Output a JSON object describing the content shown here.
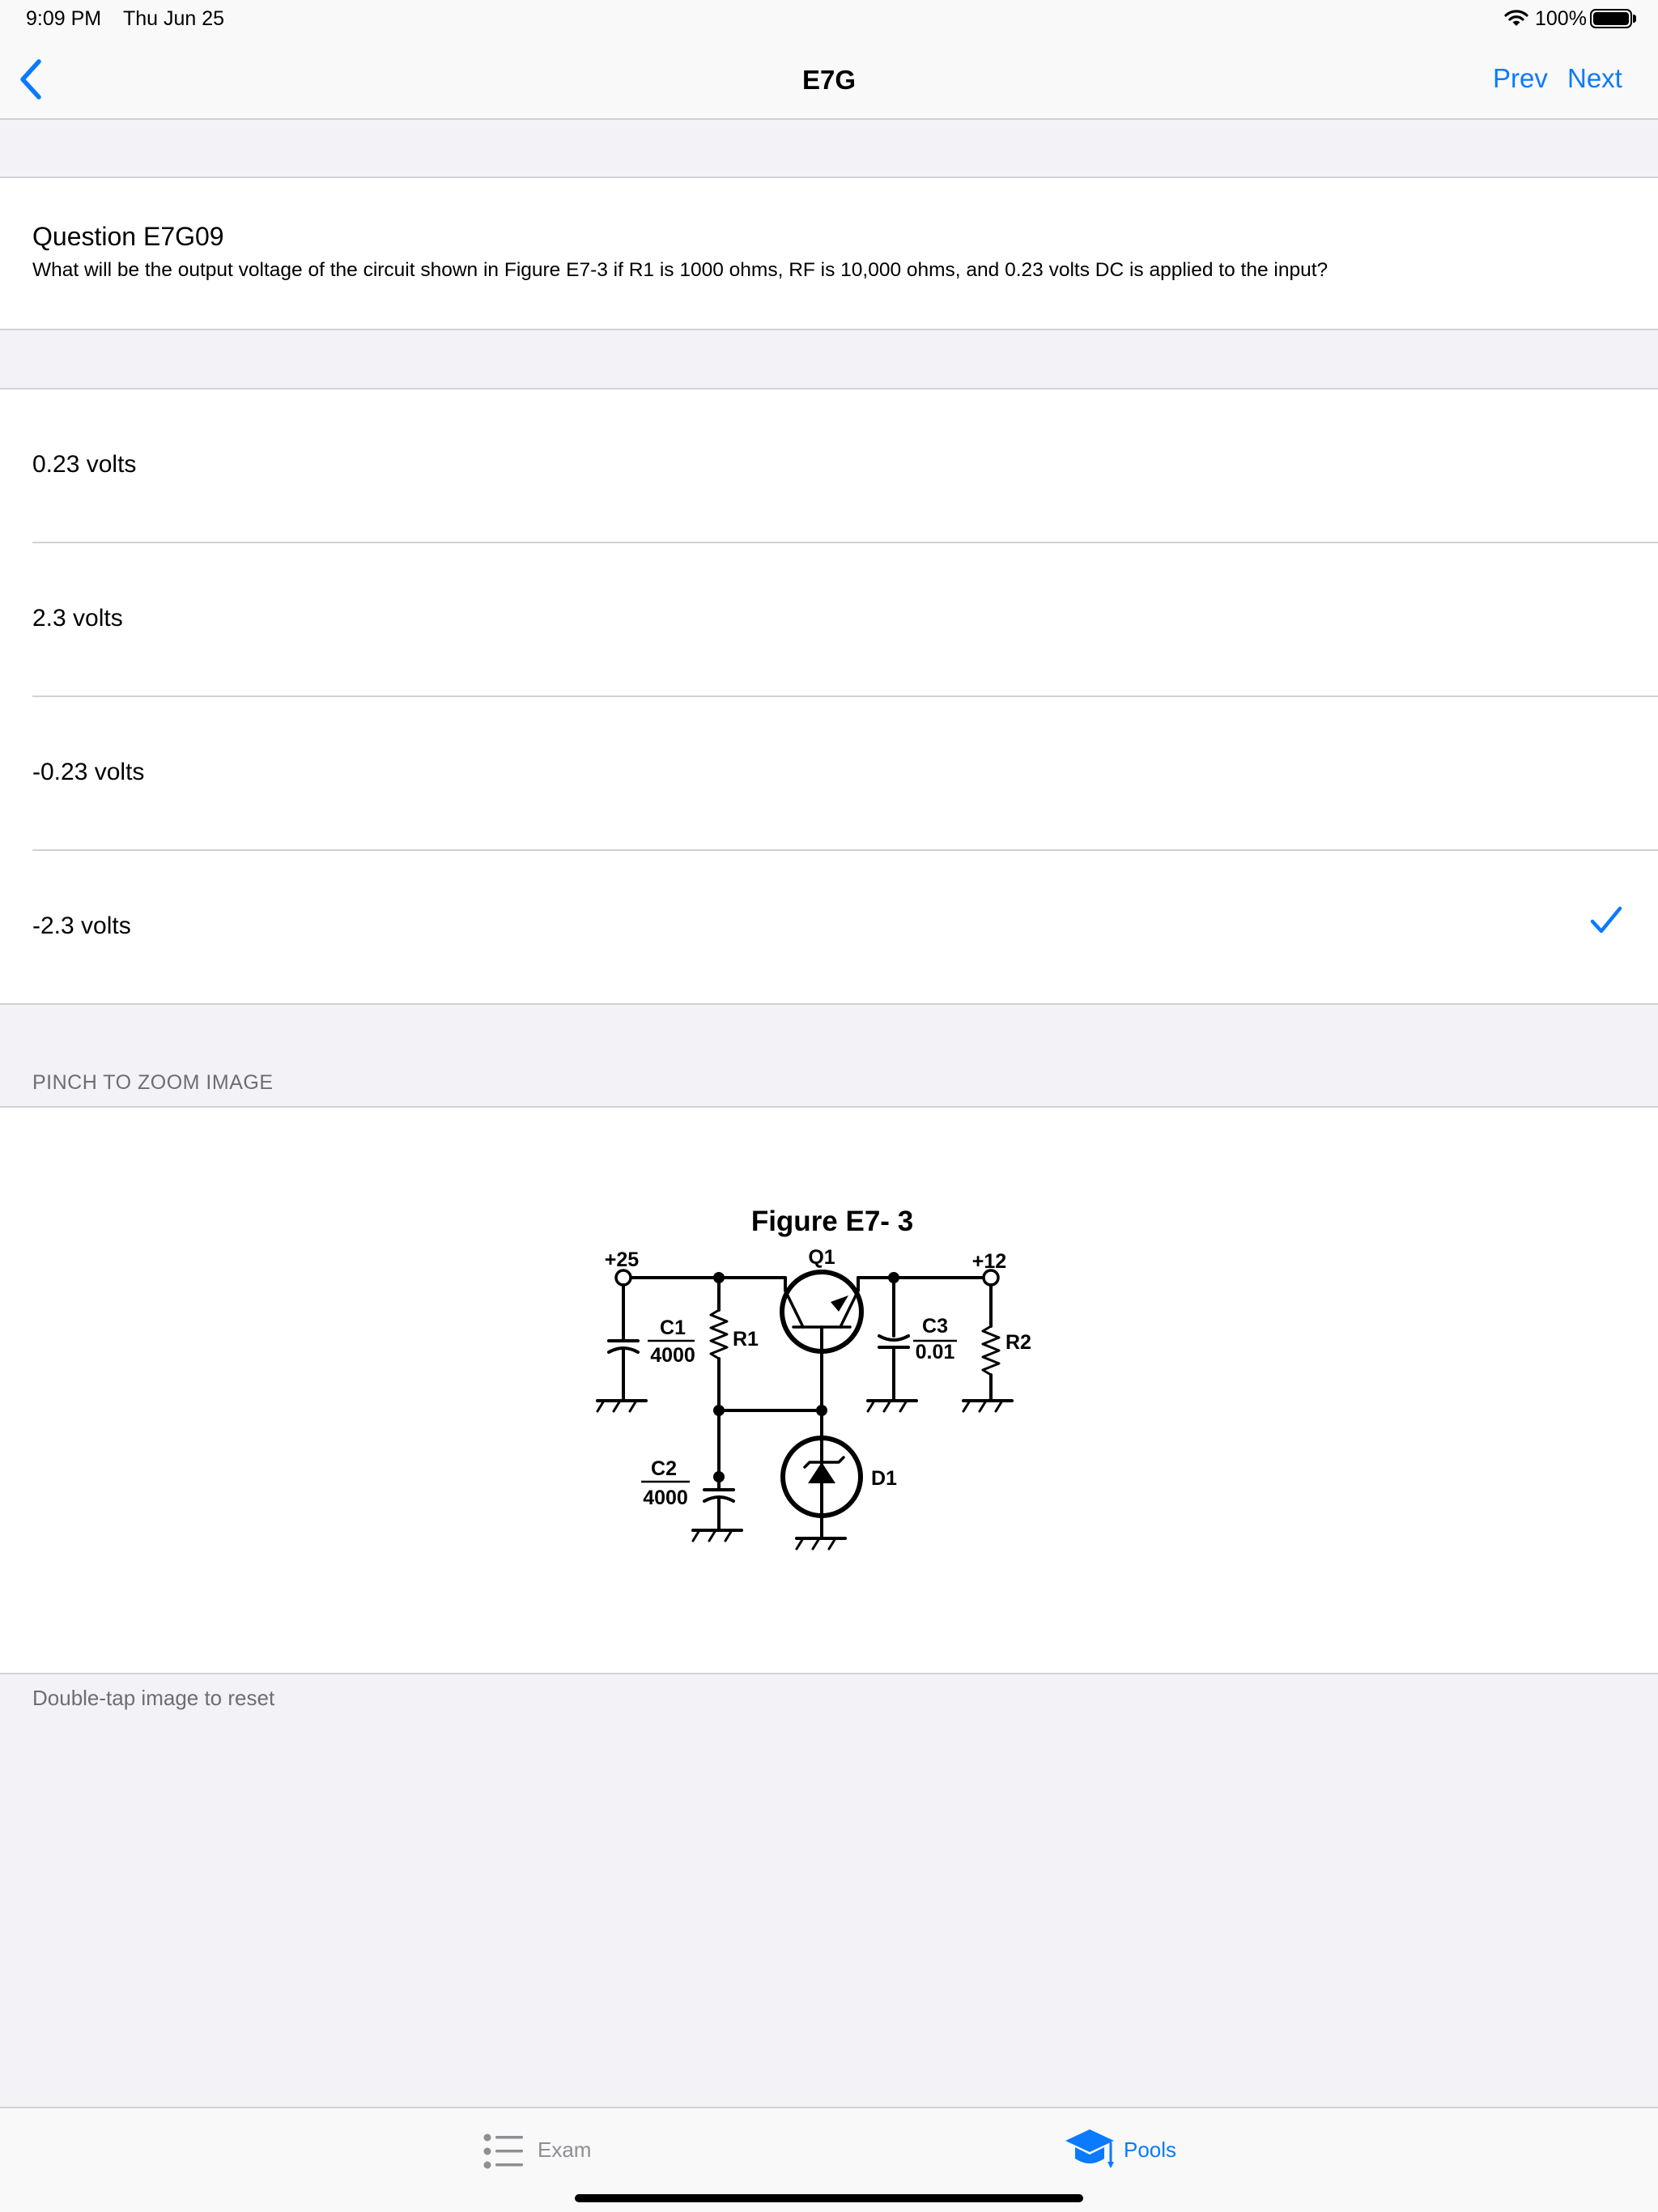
{
  "status_bar": {
    "time": "9:09 PM",
    "date": "Thu Jun 25",
    "battery": "100%",
    "icons": [
      "wifi-icon",
      "battery-icon"
    ]
  },
  "nav": {
    "title": "E7G",
    "prev_label": "Prev",
    "next_label": "Next",
    "back_icon": "chevron-left-icon"
  },
  "question": {
    "title": "Question E7G09",
    "text": "What will be the output voltage of the circuit shown in Figure E7-3 if R1 is 1000 ohms, RF is 10,000 ohms, and 0.23 volts DC is applied to the input?"
  },
  "answers": [
    {
      "label": "0.23 volts",
      "correct": false
    },
    {
      "label": "2.3 volts",
      "correct": false
    },
    {
      "label": "-0.23 volts",
      "correct": false
    },
    {
      "label": "-2.3 volts",
      "correct": true
    }
  ],
  "image_section": {
    "header": "PINCH TO ZOOM IMAGE",
    "footer": "Double-tap image to reset"
  },
  "figure": {
    "title": "Figure E7- 3",
    "v_left": "+25",
    "v_right": "+12",
    "q1": "Q1",
    "c1_name": "C1",
    "c1_value": "4000",
    "r1": "R1",
    "c3_name": "C3",
    "c3_value": "0.01",
    "r2": "R2",
    "c2_name": "C2",
    "c2_value": "4000",
    "d1": "D1"
  },
  "tabs": [
    {
      "label": "Exam",
      "icon": "list-icon",
      "active": false
    },
    {
      "label": "Pools",
      "icon": "graduation-cap-icon",
      "active": true
    }
  ],
  "colors": {
    "accent": "#0a7aff",
    "background": "#f2f2f7",
    "separator": "#d1d1d6",
    "secondary_text": "#6d6d72"
  }
}
